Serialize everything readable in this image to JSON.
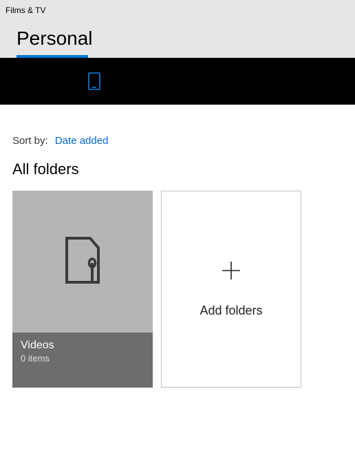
{
  "app_title": "Films & TV",
  "active_tab": "Personal",
  "sort": {
    "label": "Sort by:",
    "value": "Date added"
  },
  "section_heading": "All folders",
  "folders": [
    {
      "name": "Videos",
      "subtitle": "0 items"
    }
  ],
  "add_tile": {
    "label": "Add folders"
  },
  "colors": {
    "accent": "#0078d7",
    "link": "#0066cc"
  }
}
